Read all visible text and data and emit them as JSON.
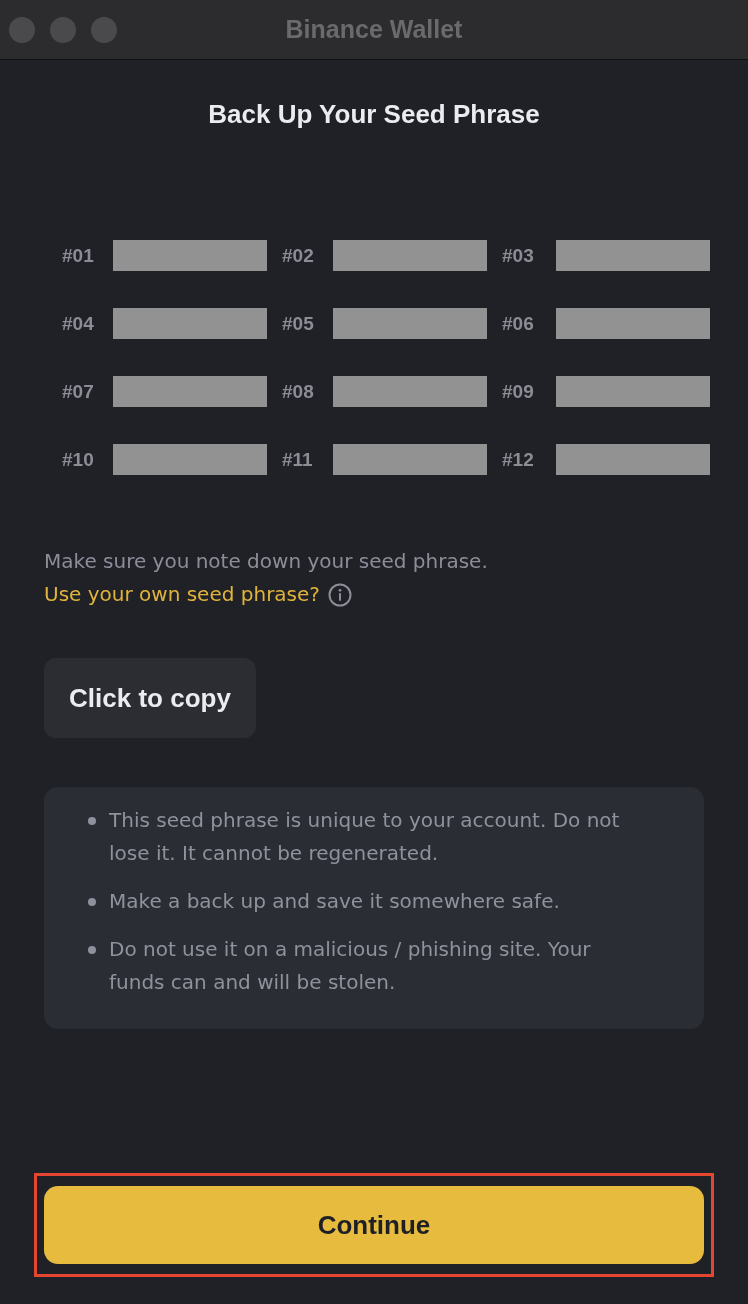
{
  "window": {
    "title": "Binance Wallet"
  },
  "heading": "Back Up Your Seed Phrase",
  "seed_words": [
    {
      "number": "#01"
    },
    {
      "number": "#02"
    },
    {
      "number": "#03"
    },
    {
      "number": "#04"
    },
    {
      "number": "#05"
    },
    {
      "number": "#06"
    },
    {
      "number": "#07"
    },
    {
      "number": "#08"
    },
    {
      "number": "#09"
    },
    {
      "number": "#10"
    },
    {
      "number": "#11"
    },
    {
      "number": "#12"
    }
  ],
  "note": "Make sure you note down your seed phrase.",
  "own_phrase_link": "Use your own seed phrase?",
  "copy_button": "Click to copy",
  "warnings": [
    "This seed phrase is unique to your account. Do not lose it. It cannot be regenerated.",
    "Make a back up and save it somewhere safe.",
    "Do not use it on a malicious / phishing site. Your funds can and will be stolen."
  ],
  "continue_button": {
    "label": "Continue",
    "highlighted": true
  }
}
